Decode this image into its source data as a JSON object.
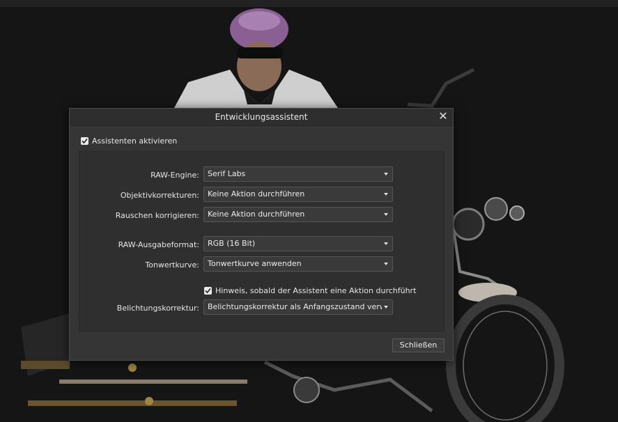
{
  "dialog": {
    "title": "Entwicklungsassistent",
    "enable_label": "Assistenten aktivieren",
    "enable_checked": true,
    "rows": [
      {
        "label": "RAW-Engine:",
        "value": "Serif Labs"
      },
      {
        "label": "Objektivkorrekturen:",
        "value": "Keine Aktion durchführen"
      },
      {
        "label": "Rauschen korrigieren:",
        "value": "Keine Aktion durchführen"
      },
      {
        "label": "RAW-Ausgabeformat:",
        "value": "RGB (16 Bit)"
      },
      {
        "label": "Tonwertkurve:",
        "value": "Tonwertkurve anwenden"
      }
    ],
    "notify_label": "Hinweis, sobald der Assistent eine Aktion durchführt",
    "notify_checked": true,
    "exposure_label": "Belichtungskorrektur:",
    "exposure_value": "Belichtungskorrektur als Anfangszustand verwenden",
    "close_label": "Schließen"
  },
  "icons": {
    "checkbox": "checkmark-icon",
    "dropdown": "chevron-down-icon",
    "close": "close-icon"
  },
  "colors": {
    "dialog_bg": "#353535",
    "panel_bg": "#2f2f2f",
    "field_bg": "#3a3a3a"
  }
}
